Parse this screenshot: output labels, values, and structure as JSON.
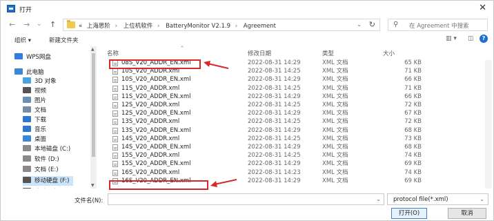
{
  "window": {
    "title": "打开"
  },
  "nav_buttons": {
    "back": "←",
    "forward": "→",
    "recent": "⌄",
    "up": "↑"
  },
  "address": {
    "overflow": "«",
    "crumbs": [
      "上海思阶",
      "上位机软件",
      "BatteryMonitor V2.1.9",
      "Agreement"
    ],
    "separator": "›"
  },
  "search": {
    "placeholder": "在 Agreement 中搜索"
  },
  "toolbar": {
    "organize": "组织 ▾",
    "new_folder": "新建文件夹",
    "view": "▥ ▾",
    "pane": "◫",
    "help": "?"
  },
  "nav_pane": {
    "items": [
      {
        "label": "WPS网盘",
        "icon": "cloud-icon",
        "color": "#2f7de1"
      },
      {
        "label": "此电脑",
        "icon": "computer-icon",
        "color": "#3a86d8"
      },
      {
        "label": "3D 对象",
        "icon": "cube-icon",
        "color": "#4aa3e0"
      },
      {
        "label": "视频",
        "icon": "video-icon",
        "color": "#555555"
      },
      {
        "label": "图片",
        "icon": "image-icon",
        "color": "#6a8fb8"
      },
      {
        "label": "文档",
        "icon": "document-icon",
        "color": "#7a8ca3"
      },
      {
        "label": "下载",
        "icon": "download-icon",
        "color": "#2a78d0"
      },
      {
        "label": "音乐",
        "icon": "music-icon",
        "color": "#2a78d0"
      },
      {
        "label": "桌面",
        "icon": "desktop-icon",
        "color": "#3a86d8"
      },
      {
        "label": "本地磁盘 (C:)",
        "icon": "drive-icon",
        "color": "#8a8a8a"
      },
      {
        "label": "软件 (D:)",
        "icon": "drive-icon",
        "color": "#8a8a8a"
      },
      {
        "label": "文档 (E:)",
        "icon": "drive-icon",
        "color": "#8a8a8a"
      },
      {
        "label": "移动硬盘 (F:)",
        "icon": "usb-drive-icon",
        "color": "#555555"
      },
      {
        "label": "移动硬盘 (F:)",
        "icon": "usb-drive-icon",
        "color": "#555555"
      }
    ],
    "selected_index": 12
  },
  "columns": {
    "name": "名称",
    "date": "修改日期",
    "type": "类型",
    "size": "大小"
  },
  "files": [
    {
      "name": "08S_V20_ADDR_EN.xml",
      "date": "2022-08-31 14:29",
      "type": "XML 文档",
      "size": "65 KB"
    },
    {
      "name": "10S_V20_ADDR.xml",
      "date": "2022-08-31 14:25",
      "type": "XML 文档",
      "size": "71 KB"
    },
    {
      "name": "10S_V20_ADDR_EN.xml",
      "date": "2022-08-31 14:29",
      "type": "XML 文档",
      "size": "66 KB"
    },
    {
      "name": "11S_V20_ADDR.xml",
      "date": "2022-08-31 14:25",
      "type": "XML 文档",
      "size": "71 KB"
    },
    {
      "name": "11S_V20_ADDR_EN.xml",
      "date": "2022-08-31 14:29",
      "type": "XML 文档",
      "size": "66 KB"
    },
    {
      "name": "12S_V20_ADDR.xml",
      "date": "2022-08-31 14:25",
      "type": "XML 文档",
      "size": "72 KB"
    },
    {
      "name": "12S_V20_ADDR_EN.xml",
      "date": "2022-08-31 14:29",
      "type": "XML 文档",
      "size": "67 KB"
    },
    {
      "name": "13S_V20_ADDR.xml",
      "date": "2022-08-31 14:25",
      "type": "XML 文档",
      "size": "72 KB"
    },
    {
      "name": "13S_V20_ADDR_EN.xml",
      "date": "2022-08-31 14:29",
      "type": "XML 文档",
      "size": "68 KB"
    },
    {
      "name": "14S_V20_ADDR.xml",
      "date": "2022-08-31 14:25",
      "type": "XML 文档",
      "size": "73 KB"
    },
    {
      "name": "14S_V20_ADDR_EN.xml",
      "date": "2022-08-31 14:29",
      "type": "XML 文档",
      "size": "68 KB"
    },
    {
      "name": "15S_V20_ADDR.xml",
      "date": "2022-08-31 14:25",
      "type": "XML 文档",
      "size": "74 KB"
    },
    {
      "name": "15S_V20_ADDR_EN.xml",
      "date": "2022-08-31 14:29",
      "type": "XML 文档",
      "size": "69 KB"
    },
    {
      "name": "16S_V20_ADDR.xml",
      "date": "2022-08-31 14:23",
      "type": "XML 文档",
      "size": "74 KB"
    },
    {
      "name": "16S_V20_ADDR_EN.xml",
      "date": "2022-08-31 14:29",
      "type": "XML 文档",
      "size": "69 KB"
    }
  ],
  "highlight_color": "#d62828",
  "bottom": {
    "filename_label": "文件名(N):",
    "filename_value": "",
    "filter": "protocol file(*.xml)",
    "open": "打开(O)",
    "cancel": "取消"
  }
}
